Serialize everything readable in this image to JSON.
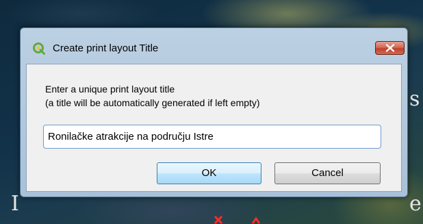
{
  "dialog": {
    "title": "Create print layout Title",
    "prompt_line_1": "Enter a unique print layout title",
    "prompt_line_2": "(a title will be automatically generated if left empty)",
    "title_value": "Ronilačke atrakcije na području Istre",
    "ok_label": "OK",
    "cancel_label": "Cancel"
  },
  "background": {
    "label_s": "s",
    "label_e": "e",
    "label_i": "I"
  },
  "icons": {
    "app": "qgis-logo-icon",
    "close": "close-icon"
  },
  "colors": {
    "accent": "#3c7fb1",
    "close_red": "#c2402a",
    "map_marker": "#ff2a2a"
  }
}
